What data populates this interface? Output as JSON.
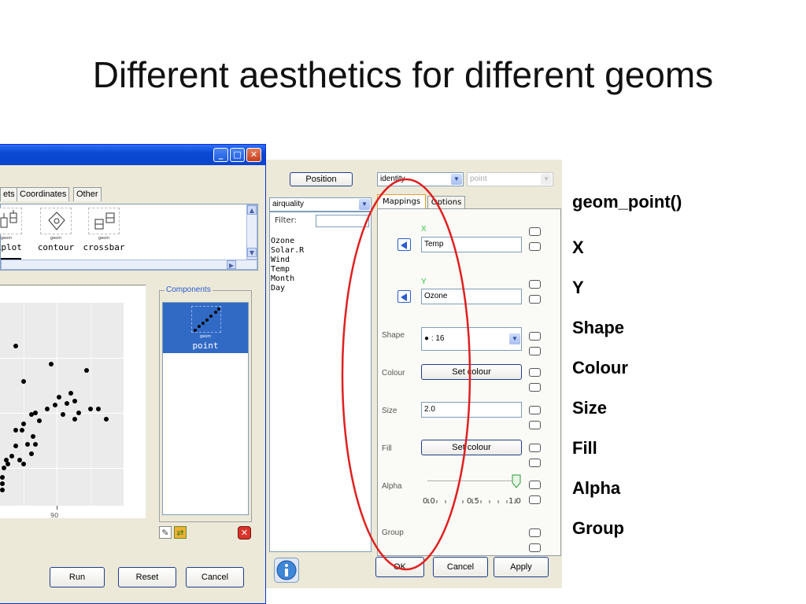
{
  "slide": {
    "title": "Different aesthetics for different geoms"
  },
  "left_window": {
    "tabs": [
      "ets",
      "Coordinates",
      "Other"
    ],
    "geoms": [
      {
        "sub": "geom",
        "label": "oxplot"
      },
      {
        "sub": "geom",
        "label": "contour"
      },
      {
        "sub": "geom",
        "label": "crossbar"
      }
    ],
    "plot_tick": "90",
    "components_label": "Components",
    "component_selected": {
      "sub": "geom",
      "label": "point"
    },
    "buttons": {
      "run": "Run",
      "reset": "Reset",
      "cancel": "Cancel"
    }
  },
  "dialog": {
    "position_button": "Position",
    "position_value": "identity",
    "geom_value": "point",
    "dataset": "airquality",
    "filter_label": "Filter:",
    "variables": [
      "Ozone",
      "Solar.R",
      "Wind",
      "Temp",
      "Month",
      "Day"
    ],
    "tabs": {
      "mappings": "Mappings",
      "options": "Options"
    },
    "x": {
      "letter": "X",
      "value": "Temp"
    },
    "y": {
      "letter": "Y",
      "value": "Ozone"
    },
    "shape": {
      "label": "Shape",
      "value": "●   : 16"
    },
    "colour": {
      "label": "Colour",
      "button": "Set colour"
    },
    "size": {
      "label": "Size",
      "value": "2.0"
    },
    "fill": {
      "label": "Fill",
      "button": "Set colour"
    },
    "alpha": {
      "label": "Alpha",
      "ticks": [
        "0.0",
        "0.5",
        "1.0"
      ],
      "value": 1.0
    },
    "group": {
      "label": "Group"
    },
    "buttons": {
      "ok": "OK",
      "cancel": "Cancel",
      "apply": "Apply"
    }
  },
  "aesthetics_list": [
    "geom_point()",
    "X",
    "Y",
    "Shape",
    "Colour",
    "Size",
    "Fill",
    "Alpha",
    "Group"
  ],
  "colors": {
    "annotation_ellipse": "#e02020",
    "titlebar": "#0a48d4",
    "selection": "#316ac5"
  }
}
